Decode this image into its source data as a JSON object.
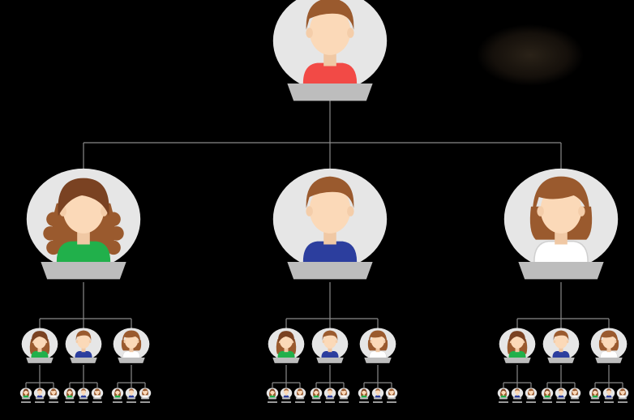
{
  "diagram": {
    "type": "hierarchy-tree",
    "background": "#000000",
    "connector_color": "#8a8a8a",
    "bubble_color": "#e6e6e6",
    "pedestal_color": "#bdbdbd",
    "skin_color": "#fbd9b8",
    "root": {
      "id": "root",
      "hair": "short-brown",
      "shirt": "#f24a46",
      "children": [
        {
          "id": "l1-left",
          "hair": "long-curly-brown",
          "shirt": "#21b04b",
          "children": [
            {
              "id": "l2-a",
              "hair": "long-brown",
              "shirt": "#21b04b"
            },
            {
              "id": "l2-b",
              "hair": "short-brown",
              "shirt": "#2c3e9e"
            },
            {
              "id": "l2-c",
              "hair": "bob-brown",
              "shirt": "#ffffff"
            }
          ]
        },
        {
          "id": "l1-center",
          "hair": "short-brown",
          "shirt": "#2c3e9e",
          "children": [
            {
              "id": "l2-d",
              "hair": "long-brown",
              "shirt": "#21b04b"
            },
            {
              "id": "l2-e",
              "hair": "short-brown",
              "shirt": "#2c3e9e"
            },
            {
              "id": "l2-f",
              "hair": "bob-brown",
              "shirt": "#ffffff"
            }
          ]
        },
        {
          "id": "l1-right",
          "hair": "bob-brown",
          "shirt": "#ffffff",
          "children": [
            {
              "id": "l2-g",
              "hair": "long-brown",
              "shirt": "#21b04b"
            },
            {
              "id": "l2-h",
              "hair": "short-brown",
              "shirt": "#2c3e9e"
            },
            {
              "id": "l2-i",
              "hair": "bob-brown",
              "shirt": "#ffffff"
            }
          ]
        }
      ]
    },
    "level3_per_person": 3,
    "level3_shirts": [
      "#21b04b",
      "#2c3e9e",
      "#ffffff"
    ]
  }
}
